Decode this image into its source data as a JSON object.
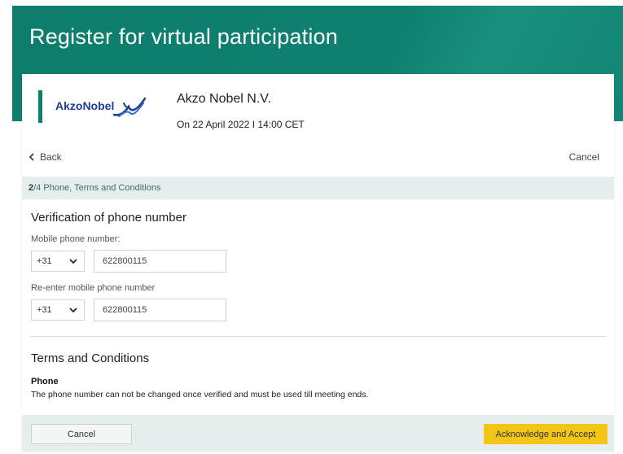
{
  "page": {
    "title": "Register for virtual participation"
  },
  "meeting": {
    "logo_text": "AkzoNobel",
    "company_name": "Akzo Nobel N.V.",
    "date_line": "On 22 April 2022 I 14:00 CET"
  },
  "nav": {
    "back_label": "Back",
    "cancel_label": "Cancel"
  },
  "step": {
    "current": "2",
    "rest": "/4 Phone, Terms and Conditions"
  },
  "verification": {
    "title": "Verification of phone number",
    "mobile_label": "Mobile phone number:",
    "mobile_country_code": "+31",
    "mobile_value": "622800115",
    "reenter_label": "Re-enter mobile phone number",
    "reenter_country_code": "+31",
    "reenter_value": "622800115"
  },
  "terms": {
    "title": "Terms and Conditions",
    "phone_heading": "Phone",
    "phone_text": "The phone number can not be changed once verified and must be used till meeting ends."
  },
  "footer": {
    "cancel_label": "Cancel",
    "accept_label": "Acknowledge and Accept"
  },
  "colors": {
    "header": "#0f8070",
    "step_bar": "#e6eeed",
    "accept_button": "#f3c516",
    "logo_blue": "#1c3f94"
  },
  "icons": [
    "chevron-left-icon",
    "chevron-down-icon",
    "akzonobel-logo"
  ]
}
